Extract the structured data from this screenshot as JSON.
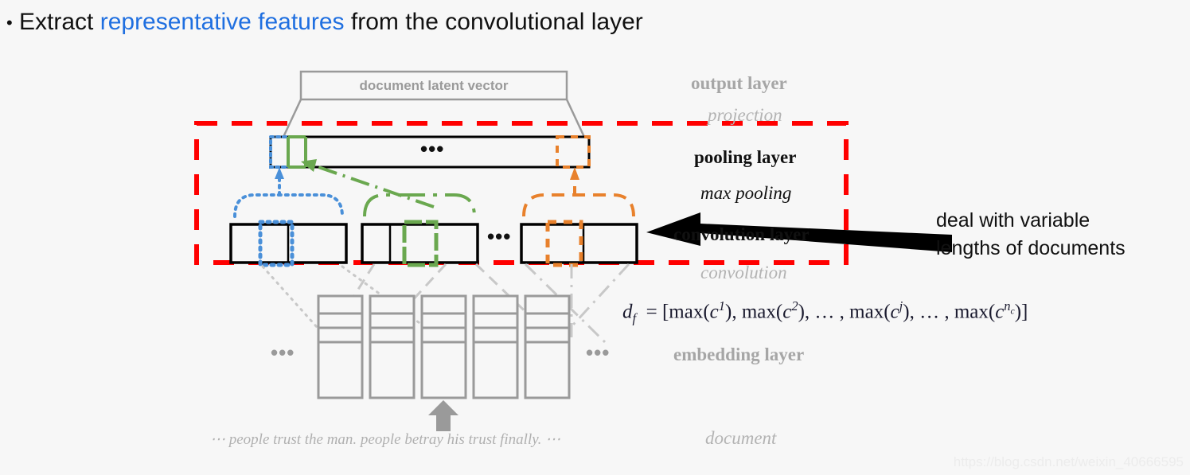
{
  "slide": {
    "background_color": "#f7f7f7",
    "bullet": {
      "marker": "•",
      "prefix": "Extract ",
      "highlight": "representative features",
      "highlight_color": "#1f6fe0",
      "suffix": " from the convolutional layer"
    },
    "watermark": "https://blog.csdn.net/weixin_40666595"
  },
  "diagram": {
    "title_box": {
      "label": "document latent vector",
      "color": "#9a9a9a"
    },
    "layer_labels": [
      {
        "text": "output layer",
        "style": "serif-gray-bold"
      },
      {
        "text": "projection",
        "style": "serif-gray-italic"
      },
      {
        "text": "pooling layer",
        "style": "serif-black-bold"
      },
      {
        "text": "max pooling",
        "style": "serif-black-italic"
      },
      {
        "text": "convolution layer",
        "style": "serif-black-bold"
      },
      {
        "text": "convolution",
        "style": "serif-gray-italic"
      },
      {
        "text": "embedding layer",
        "style": "serif-gray-bold"
      },
      {
        "text": "document",
        "style": "serif-gray-italic"
      }
    ],
    "callout": {
      "line1": "deal with variable",
      "line2": "lengths of documents",
      "arrow_color": "#000000"
    },
    "highlight_box_color": "#ff0000",
    "feature_colors": {
      "blue": "#4a90d9",
      "green": "#6aa84f",
      "orange": "#e8812c",
      "gray": "#9a9a9a",
      "black": "#000000"
    },
    "ellipsis": {
      "pooling": "•••",
      "convolution": "•••",
      "embedding_left": "•••",
      "embedding_right": "•••"
    },
    "document_sentence": "⋯ people trust the man. people betray his trust finally. ⋯",
    "formula": {
      "lhs": "d",
      "lhs_sub": "f",
      "equals": "=",
      "body": "[max(c¹), max(c²), …, max(c^j), …, max(c^{n_c})]",
      "terms": [
        "max(c1)",
        "max(c2)",
        "...",
        "max(cj)",
        "...",
        "max(cnc)"
      ]
    }
  }
}
